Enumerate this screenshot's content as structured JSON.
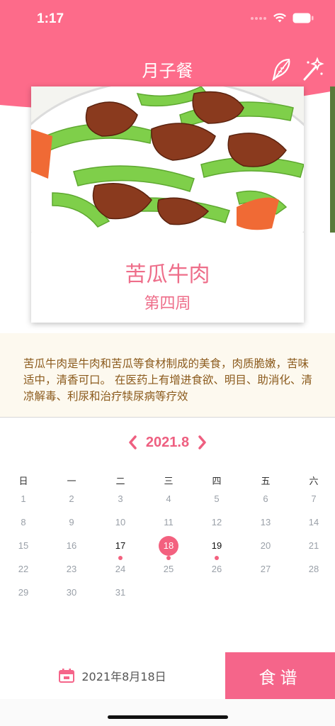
{
  "status_bar": {
    "time": "1:17"
  },
  "nav": {
    "title": "月子餐"
  },
  "card": {
    "title": "苦瓜牛肉",
    "subtitle": "第四周"
  },
  "description": "苦瓜牛肉是牛肉和苦瓜等食材制成的美食，肉质脆嫩，苦味适中，清香可口。 在医药上有增进食欲、明目、助消化、清凉解毒、利尿和治疗犊尿病等疗效",
  "calendar": {
    "month": "2021.8",
    "weekdays": [
      "日",
      "一",
      "二",
      "三",
      "四",
      "五",
      "六"
    ],
    "weeks": [
      [
        "1",
        "2",
        "3",
        "4",
        "5",
        "6",
        "7"
      ],
      [
        "8",
        "9",
        "10",
        "11",
        "12",
        "13",
        "14"
      ],
      [
        "15",
        "16",
        "17",
        "18",
        "19",
        "20",
        "21"
      ],
      [
        "22",
        "23",
        "24",
        "25",
        "26",
        "27",
        "28"
      ],
      [
        "29",
        "30",
        "31",
        "",
        "",
        "",
        ""
      ]
    ],
    "selected": "18",
    "marked": [
      "17",
      "18",
      "19"
    ]
  },
  "footer": {
    "date": "2021年8月18日",
    "recipe_button": "食谱"
  },
  "colors": {
    "accent": "#f5658a",
    "description_text": "#8b5a1c",
    "description_bg": "#fdf9ef"
  },
  "icons": [
    "wifi-icon",
    "battery-icon",
    "feather-icon",
    "magic-wand-icon",
    "chevron-left-icon",
    "chevron-right-icon",
    "calendar-icon"
  ]
}
